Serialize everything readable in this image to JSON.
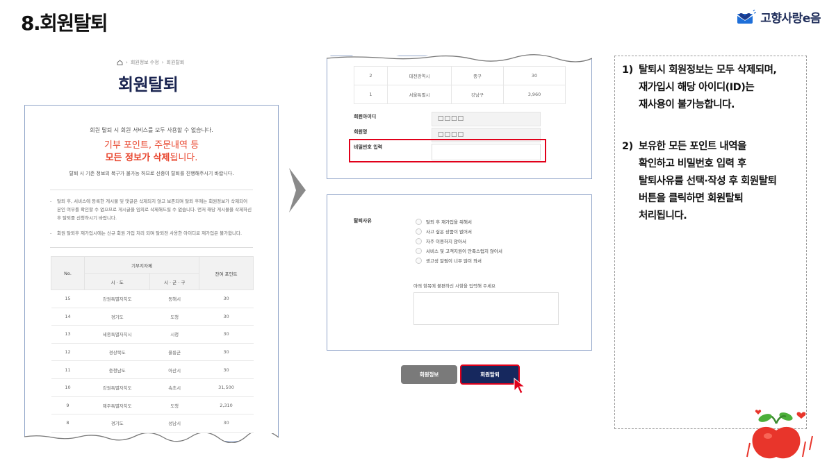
{
  "slide": {
    "title": "8.회원탈퇴",
    "brand": "고향사랑e음"
  },
  "left_screen": {
    "breadcrumb": [
      "회원정보 수정",
      "회원탈퇴"
    ],
    "heading": "회원탈퇴",
    "notice_top": "회원 탈퇴 시 회원 서비스를 모두 사용할 수 없습니다.",
    "notice_red_1": "기부 포인트, 주문내역 등",
    "notice_red_2a": "모든 정보가 삭제",
    "notice_red_2b": "됩니다.",
    "notice_bottom": "탈퇴 시 기존 정보의 복구가 불가능 하므로 신중이 탈퇴를 진행해주시기 바랍니다.",
    "bullets": [
      "탈퇴 후, 서비스에 등록한 게시물 및 댓글은 삭제되지 않고 보존되며 탈퇴 후에는 회원정보가 삭제되어 본인 여부를 확인할 수 없으므로 게시글을 임의로 삭제해드릴 수 없습니다. 먼저 해당 게시물을 삭제하신 후 탈퇴를 신청하시기 바랍니다.",
      "회원 탈퇴후 재가입시에는 신규 회원 가입 처리 되며 탈퇴전 사용한 아이디로 재가입은 불가합니다."
    ],
    "table": {
      "col_no": "No.",
      "col_group": "기부지자체",
      "col_sido": "시 · 도",
      "col_sigungu": "시 · 군 · 구",
      "col_points": "잔여 포인트",
      "rows": [
        [
          "15",
          "강원특별자치도",
          "동해시",
          "30"
        ],
        [
          "14",
          "경기도",
          "도청",
          "30"
        ],
        [
          "13",
          "세종특별자치시",
          "시청",
          "30"
        ],
        [
          "12",
          "경상북도",
          "울릉군",
          "30"
        ],
        [
          "11",
          "충청남도",
          "아산시",
          "30"
        ],
        [
          "10",
          "강원특별자치도",
          "속초시",
          "31,500"
        ],
        [
          "9",
          "제주특별자치도",
          "도청",
          "2,310"
        ],
        [
          "8",
          "경기도",
          "성남시",
          "30"
        ]
      ]
    }
  },
  "right_top": {
    "rows": [
      [
        "2",
        "대전광역시",
        "중구",
        "30"
      ],
      [
        "1",
        "서울특별시",
        "강남구",
        "3,960"
      ]
    ],
    "id_label": "회원아이디",
    "id_value": "□□□□",
    "name_label": "회원명",
    "name_value": "□□□□",
    "pw_label": "비밀번호 입력"
  },
  "right_bottom": {
    "reason_label": "탈퇴사유",
    "reasons": [
      "탈퇴 후 재가입을 위해서",
      "사고 싶은 상품이 없어서",
      "자주 이용하지 않아서",
      "서비스 및 고객지원이 만족스럽지 않아서",
      "광고성 알림이 너무 많이 와서"
    ],
    "prompt": "아래 항목에 불편하신 사항을 입력해 주세요"
  },
  "buttons": {
    "info": "회원정보",
    "withdraw": "회원탈퇴"
  },
  "instructions": {
    "step1_num": "1)",
    "step1_lines": [
      "탈퇴시 회원정보는 모두 삭제되며,",
      "재가입시 해당 아이디(ID)는",
      "재사용이 불가능합니다."
    ],
    "step2_num": "2)",
    "step2_lines": [
      "보유한 모든 포인트 내역을",
      "확인하고 비밀번호 입력 후",
      "탈퇴사유를 선택·작성 후 회원탈퇴",
      "버튼을 클릭하면 회원탈퇴",
      "처리됩니다."
    ]
  },
  "colors": {
    "navy": "#16285e",
    "red": "#e8442c",
    "highlight": "#e1001a",
    "brand_blue": "#1e6fd9"
  }
}
